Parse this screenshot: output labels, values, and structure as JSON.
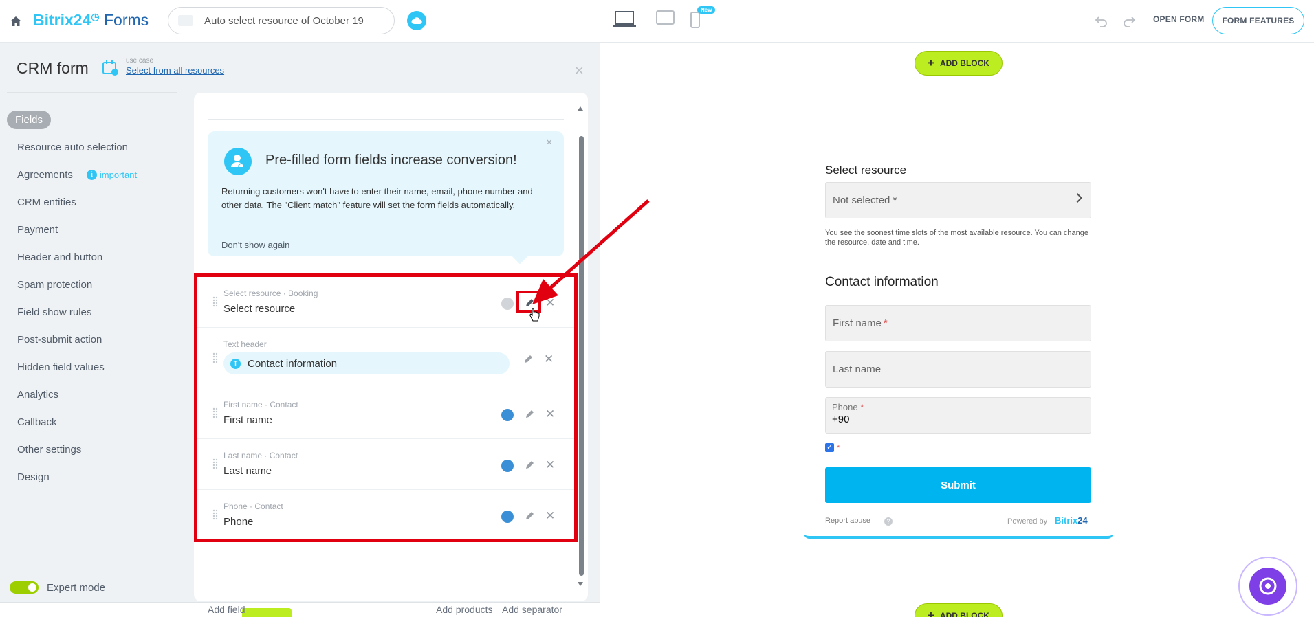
{
  "topbar": {
    "logo_bitrix": "Bitrix24",
    "logo_forms": "Forms",
    "form_name": "Auto select resource of October 19",
    "new_badge": "New",
    "open_form": "OPEN FORM",
    "form_features": "FORM FEATURES"
  },
  "panel": {
    "title": "CRM form",
    "use_case_label": "use case",
    "use_case_link": "Select from all resources",
    "nav": [
      {
        "label": "Fields",
        "active": true
      },
      {
        "label": "Resource auto selection"
      },
      {
        "label": "Agreements",
        "badge": "important"
      },
      {
        "label": "CRM entities"
      },
      {
        "label": "Payment"
      },
      {
        "label": "Header and button"
      },
      {
        "label": "Spam protection"
      },
      {
        "label": "Field show rules"
      },
      {
        "label": "Post-submit action"
      },
      {
        "label": "Hidden field values"
      },
      {
        "label": "Analytics"
      },
      {
        "label": "Callback"
      },
      {
        "label": "Other settings"
      },
      {
        "label": "Design"
      }
    ],
    "expert_mode": "Expert mode"
  },
  "promo": {
    "title": "Pre-filled form fields increase conversion!",
    "text": "Returning customers won't have to enter their name, email, phone number and other data. The \"Client match\" feature will set the form fields automatically.",
    "dont_show": "Don't show again"
  },
  "fields": [
    {
      "sub": "Select resource · Booking",
      "main": "Select resource"
    },
    {
      "sub": "Text header",
      "main": "Contact information",
      "pill_icon": "T"
    },
    {
      "sub": "First name · Contact",
      "main": "First name"
    },
    {
      "sub": "Last name · Contact",
      "main": "Last name"
    },
    {
      "sub": "Phone · Contact",
      "main": "Phone"
    }
  ],
  "footer_actions": {
    "add_field": "Add field",
    "add_products": "Add products",
    "add_separator": "Add separator"
  },
  "preview": {
    "add_block": "ADD BLOCK",
    "select_resource_label": "Select resource",
    "select_placeholder": "Not selected *",
    "hint": "You see the soonest time slots of the most available resource. You can change the resource, date and time.",
    "contact_heading": "Contact information",
    "first_name": "First name",
    "last_name": "Last name",
    "phone_label": "Phone",
    "phone_value": "+90",
    "required_mark": "*",
    "submit": "Submit",
    "report_abuse": "Report abuse",
    "help": "?",
    "powered_by": "Powered by",
    "brand_bitrix": "Bitrix",
    "brand_24": "24"
  },
  "colors": {
    "accent": "#2fc6f6",
    "green": "#bbed21",
    "highlight_red": "#e0000f",
    "submit_blue": "#00b4f0"
  }
}
